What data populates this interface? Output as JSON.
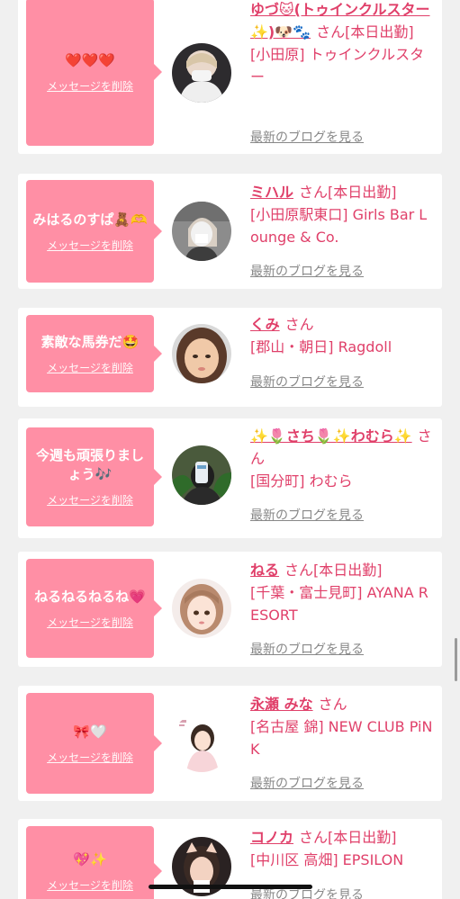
{
  "delete_label": "メッセージを削除",
  "blog_label": "最新のブログを見る",
  "san_label": "さん",
  "colors": {
    "bubble": "#ff8fa5",
    "accent": "#e0406a",
    "link_gray": "#888888"
  },
  "cards": [
    {
      "message": "❤️❤️❤️",
      "name": "ゆづ🐱(トゥインクルスター✨)🐶🐾",
      "status": "[本日出勤]",
      "shop": "[小田原] トゥインクルスター"
    },
    {
      "message": "みはるのすぱ🧸🫶",
      "name": "ミハル",
      "status": "[本日出勤]",
      "shop": "[小田原駅東口] Girls Bar Lounge & Co."
    },
    {
      "message": "素敵な馬券だ🤩",
      "name": "くみ",
      "status": "",
      "shop": "[郡山・朝日] Ragdoll"
    },
    {
      "message": "今週も頑張りましょう🎶",
      "name": "✨🌷さち🌷✨わむら✨",
      "status": "",
      "shop": "[国分町] わむら"
    },
    {
      "message": "ねるねるねるね💗",
      "name": "ねる",
      "status": "[本日出勤]",
      "shop": "[千葉・富士見町] AYANA RESORT"
    },
    {
      "message": "🎀🤍",
      "name": "永瀬 みな",
      "status": "",
      "shop": "[名古屋 錦] NEW CLUB PiNK"
    },
    {
      "message": "💖✨",
      "name": "コノカ",
      "status": "[本日出勤]",
      "shop": "[中川区 高畑] EPSILON"
    }
  ]
}
